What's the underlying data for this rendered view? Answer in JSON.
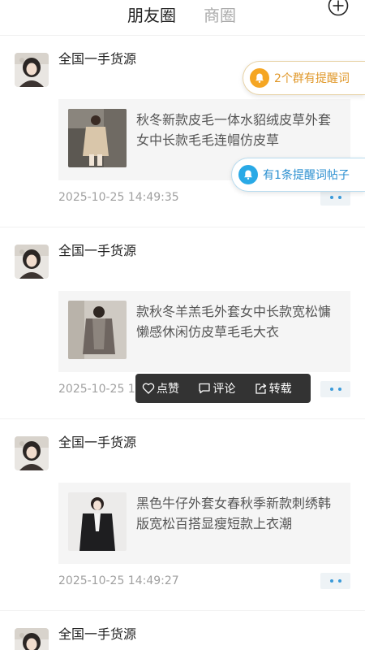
{
  "header": {
    "tabs": [
      {
        "label": "朋友圈",
        "active": true
      },
      {
        "label": "商圈",
        "active": false
      }
    ],
    "add_icon": "plus-circle-icon"
  },
  "posts": [
    {
      "username": "全国一手货源",
      "text": "秋冬新款皮毛一体水貂绒皮草外套女中长款毛毛连帽仿皮草",
      "time": "2025-10-25 14:49:35"
    },
    {
      "username": "全国一手货源",
      "text": "款秋冬羊羔毛外套女中长款宽松慵懒感休闲仿皮草毛毛大衣",
      "time": "2025-10-25 14:49:31"
    },
    {
      "username": "全国一手货源",
      "text": "黑色牛仔外套女春秋季新款刺绣韩版宽松百搭显瘦短款上衣潮",
      "time": "2025-10-25 14:49:27"
    },
    {
      "username": "全国一手货源"
    }
  ],
  "actions": {
    "like": "点赞",
    "comment": "评论",
    "share": "转载"
  },
  "reminders": {
    "group_reminder": "2个群有提醒词",
    "post_reminder": "有1条提醒词帖子"
  },
  "colors": {
    "accent_blue": "#3a9ad9",
    "reminder_orange": "#f5a623",
    "reminder_blue": "#29a9e6",
    "popover_bg": "#333333"
  }
}
